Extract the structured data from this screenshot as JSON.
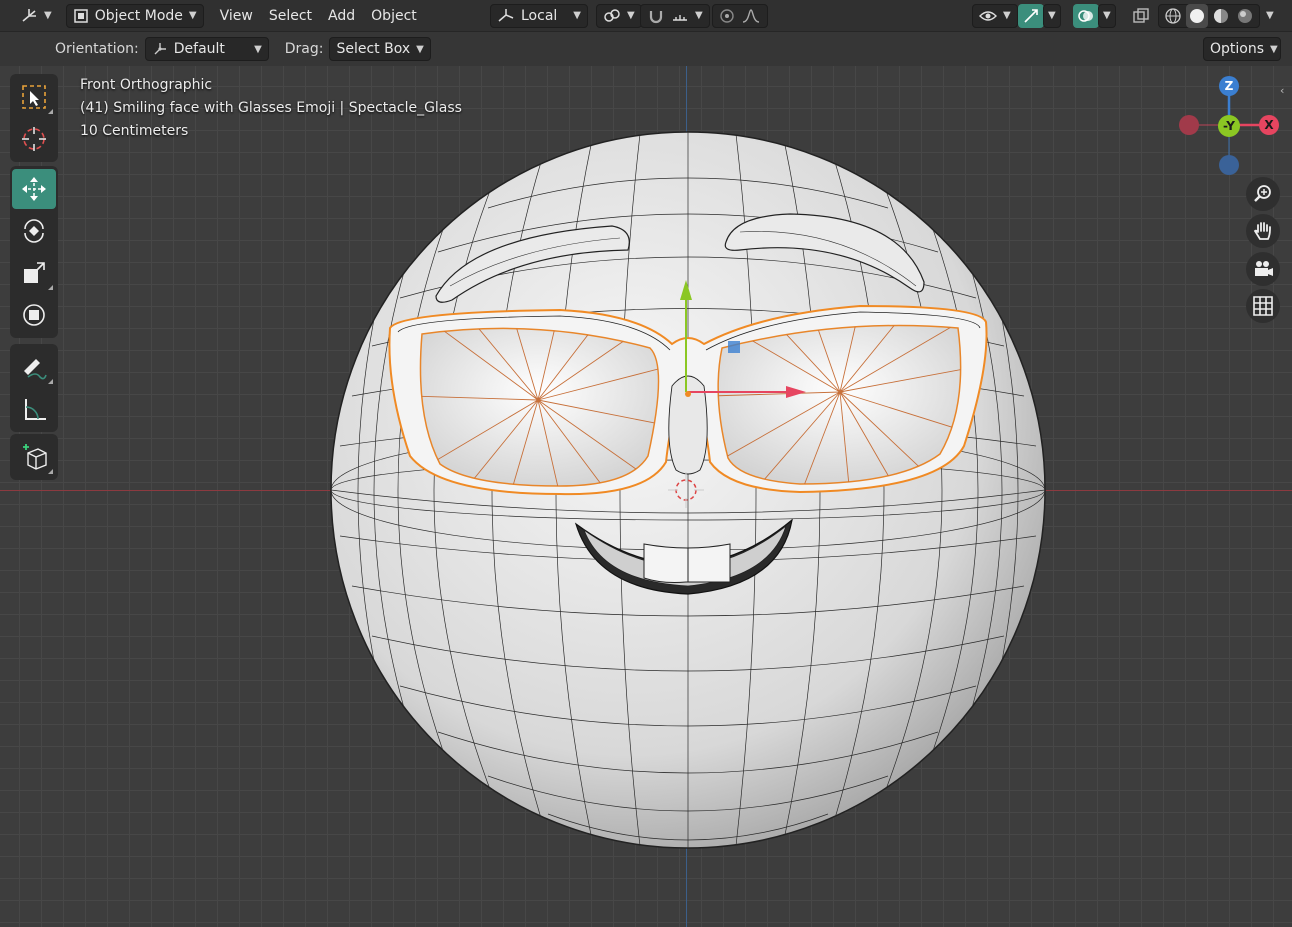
{
  "header": {
    "editor_type_icon": "axis-gizmo-icon",
    "mode_label": "Object Mode",
    "menus": [
      "View",
      "Select",
      "Add",
      "Object"
    ],
    "transform_orientation": "Local",
    "pivot_icon": "pivot-link-icon",
    "snap_icon": "snap-magnet-icon",
    "proportional_icon": "proportional-edit-icon",
    "visibility_icon": "eye-icon",
    "gizmo_icon": "gizmo-toggle-icon",
    "overlay_icon": "overlay-toggle-icon",
    "xray_icon": "xray-icon",
    "shading_modes": [
      "wireframe",
      "solid",
      "material-preview",
      "rendered"
    ],
    "active_shading": "solid"
  },
  "subheader": {
    "orientation_label": "Orientation:",
    "orientation_value": "Default",
    "drag_label": "Drag:",
    "drag_value": "Select Box",
    "options_label": "Options"
  },
  "viewport": {
    "view_name": "Front Orthographic",
    "object_info": "(41) Smiling face with Glasses Emoji | Spectacle_Glass",
    "scale_info": "10 Centimeters"
  },
  "toolbar": {
    "tools": [
      {
        "name": "select-box",
        "icon": "select-box-icon",
        "active": false
      },
      {
        "name": "cursor",
        "icon": "cursor-icon",
        "active": false
      },
      {
        "name": "move",
        "icon": "move-icon",
        "active": true
      },
      {
        "name": "rotate",
        "icon": "rotate-icon",
        "active": false
      },
      {
        "name": "scale",
        "icon": "scale-icon",
        "active": false
      },
      {
        "name": "transform",
        "icon": "transform-icon",
        "active": false
      },
      {
        "name": "annotate",
        "icon": "annotate-icon",
        "active": false
      },
      {
        "name": "measure",
        "icon": "measure-icon",
        "active": false
      },
      {
        "name": "add-cube",
        "icon": "add-cube-icon",
        "active": false
      }
    ]
  },
  "nav_gizmo": {
    "z_label": "Z",
    "y_label": "-Y",
    "x_label": "X",
    "colors": {
      "x": "#e64560",
      "y": "#8bc723",
      "z": "#3b7fd1"
    }
  },
  "nav_buttons": [
    "zoom-icon",
    "hand-pan-icon",
    "camera-icon",
    "grid-ortho-icon"
  ],
  "colors": {
    "active_tool": "#3b8e7c",
    "header_bg": "#303030",
    "viewport_bg": "#3d3d3d",
    "selection_outline": "#f08a24"
  }
}
